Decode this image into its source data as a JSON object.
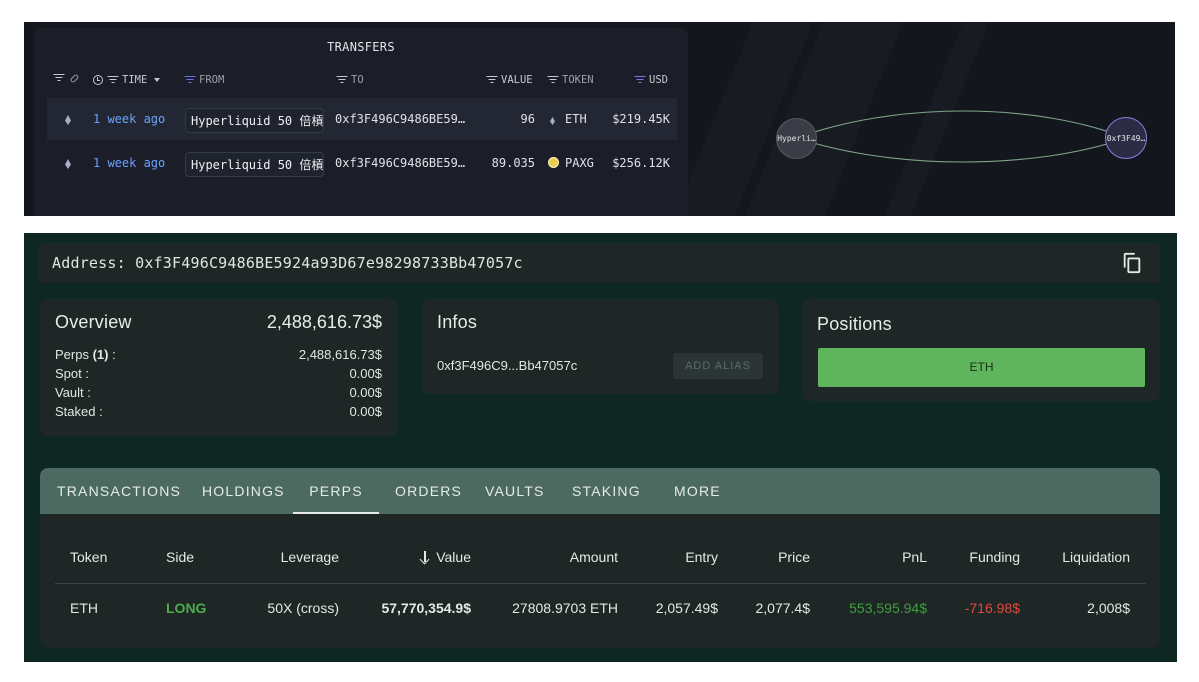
{
  "transfers": {
    "title": "TRANSFERS",
    "headers": {
      "time": "TIME",
      "from": "FROM",
      "to": "TO",
      "value": "VALUE",
      "token": "TOKEN",
      "usd": "USD"
    },
    "rows": [
      {
        "time": "1 week ago",
        "from": "Hyperliquid 50 倍槓",
        "to": "0xf3F496C9486BE59…",
        "value": "96",
        "token": "ETH",
        "usd": "$219.45K"
      },
      {
        "time": "1 week ago",
        "from": "Hyperliquid 50 倍槓",
        "to": "0xf3F496C9486BE59…",
        "value": "89.035",
        "token": "PAXG",
        "usd": "$256.12K"
      }
    ]
  },
  "graph": {
    "node_from": "Hyperli…",
    "node_to": "0xf3F49…",
    "edge_color": "#7fa58a"
  },
  "address_bar": {
    "label": "Address:",
    "address": "0xf3F496C9486BE5924a93D67e98298733Bb47057c"
  },
  "overview": {
    "title": "Overview",
    "total": "2,488,616.73$",
    "perps_label": "Perps",
    "perps_count": "(1)",
    "perps_value": "2,488,616.73$",
    "spot_label": "Spot :",
    "spot_value": "0.00$",
    "vault_label": "Vault :",
    "vault_value": "0.00$",
    "staked_label": "Staked :",
    "staked_value": "0.00$"
  },
  "infos": {
    "title": "Infos",
    "short_address": "0xf3F496C9...Bb47057c",
    "alias_button": "ADD ALIAS"
  },
  "positions": {
    "title": "Positions",
    "items": [
      "ETH"
    ]
  },
  "tabs": [
    "TRANSACTIONS",
    "HOLDINGS",
    "PERPS",
    "ORDERS",
    "VAULTS",
    "STAKING",
    "MORE"
  ],
  "active_tab": "PERPS",
  "perps_table": {
    "columns": [
      "Token",
      "Side",
      "Leverage",
      "Value",
      "Amount",
      "Entry",
      "Price",
      "PnL",
      "Funding",
      "Liquidation"
    ],
    "rows": [
      {
        "token": "ETH",
        "side": "LONG",
        "leverage": "50X (cross)",
        "value": "57,770,354.9$",
        "amount": "27808.9703 ETH",
        "entry": "2,057.49$",
        "price": "2,077.4$",
        "pnl": "553,595.94$",
        "funding": "-716.98$",
        "liquidation": "2,008$"
      }
    ]
  },
  "colors": {
    "long": "#4cae4f",
    "pnl_positive": "#3f9d3f",
    "funding_negative": "#e2483d",
    "time_link": "#6aa3ff",
    "positions_button": "#5fb55b",
    "tabs_bar": "#4d6a61"
  }
}
